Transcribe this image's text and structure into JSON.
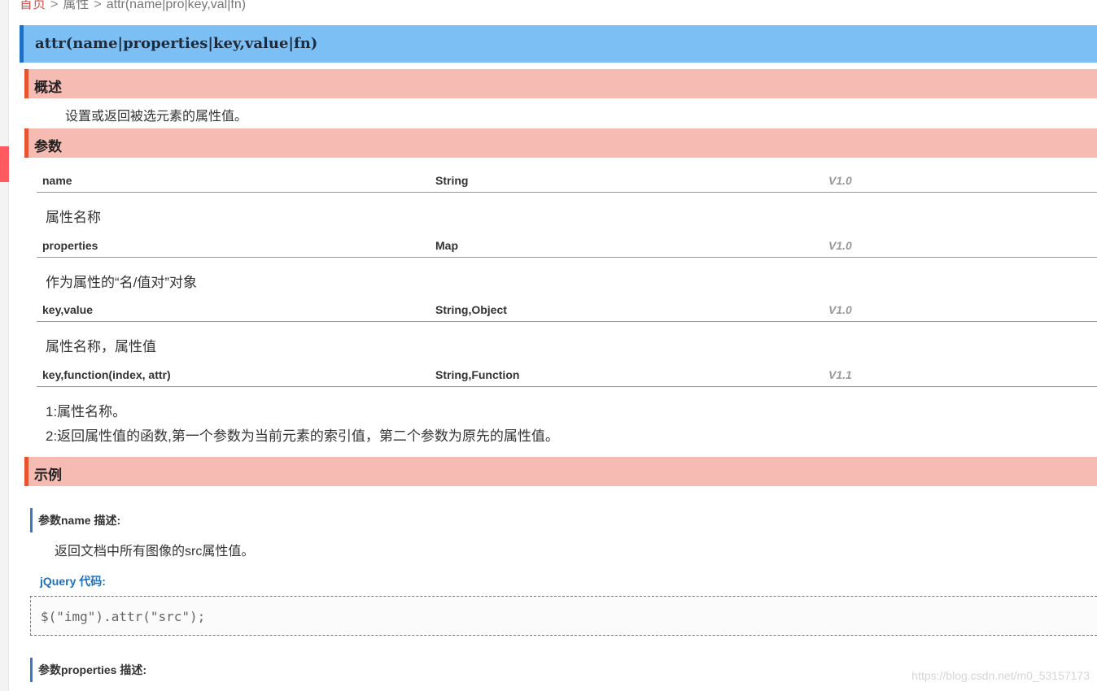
{
  "breadcrumb": {
    "home": "首页",
    "sep1": ">",
    "category": "属性",
    "sep2": ">",
    "current": "attr(name|pro|key,val|fn)"
  },
  "page_title": "attr(name|properties|key,value|fn)",
  "overview": {
    "heading": "概述",
    "text": "设置或返回被选元素的属性值。"
  },
  "params": {
    "heading": "参数",
    "items": [
      {
        "name": "name",
        "type": "String",
        "version": "V1.0",
        "desc": "属性名称"
      },
      {
        "name": "properties",
        "type": "Map",
        "version": "V1.0",
        "desc": "作为属性的“名/值对”对象"
      },
      {
        "name": "key,value",
        "type": "String,Object",
        "version": "V1.0",
        "desc": "属性名称，属性值"
      },
      {
        "name": "key,function(index, attr)",
        "type": "String,Function",
        "version": "V1.1",
        "desc_lines": [
          "1:属性名称。",
          "2:返回属性值的函数,第一个参数为当前元素的索引值，第二个参数为原先的属性值。"
        ]
      }
    ]
  },
  "examples": {
    "heading": "示例",
    "items": [
      {
        "title": "参数name 描述:",
        "desc": "返回文档中所有图像的src属性值。",
        "code_label": "jQuery 代码:",
        "code": "$(\"img\").attr(\"src\");"
      },
      {
        "title": "参数properties 描述:"
      }
    ]
  },
  "watermark": "https://blog.csdn.net/m0_53157173",
  "colors": {
    "title_bg": "#7bbff5",
    "section_bg": "#f6bcb4",
    "section_accent": "#e8542e",
    "link_blue": "#1f6fbf"
  }
}
